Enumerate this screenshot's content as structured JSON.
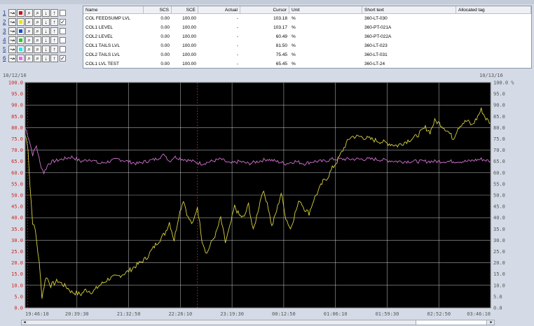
{
  "controls": {
    "rows": [
      {
        "num": "1",
        "color": "#cc1111",
        "checked": false
      },
      {
        "num": "2",
        "color": "#e8e800",
        "checked": true
      },
      {
        "num": "3",
        "color": "#1a4ad6",
        "checked": false
      },
      {
        "num": "4",
        "color": "#22cc22",
        "checked": false
      },
      {
        "num": "5",
        "color": "#22e8e8",
        "checked": false
      },
      {
        "num": "6",
        "color": "#ee66ee",
        "checked": true
      }
    ],
    "glyphs": {
      "trend": "↝",
      "zoom": "⌕",
      "down": "↓",
      "up": "↑",
      "check": "✓"
    }
  },
  "table": {
    "headers": {
      "name": "Name",
      "scs": "SCS",
      "sce": "SCE",
      "actual": "Actual",
      "cursor": "Cursor",
      "unit": "Unit",
      "short_text": "Short text",
      "allocated_tag": "Allocated tag"
    },
    "rows": [
      {
        "name": "COL FEEDSUMP LVL",
        "scs": "0.00",
        "sce": "100.00",
        "actual": "-",
        "cursor": "103.18",
        "unit": "%",
        "short_text": "360-LT-030",
        "allocated_tag": ""
      },
      {
        "name": "COL1 LEVEL",
        "scs": "0.00",
        "sce": "100.00",
        "actual": "-",
        "cursor": "103.17",
        "unit": "%",
        "short_text": "360-PT-021A",
        "allocated_tag": ""
      },
      {
        "name": "COL2 LEVEL",
        "scs": "0.00",
        "sce": "100.00",
        "actual": "-",
        "cursor": "60.49",
        "unit": "%",
        "short_text": "360-PT-022A",
        "allocated_tag": ""
      },
      {
        "name": "COL1 TAILS LVL",
        "scs": "0.00",
        "sce": "100.00",
        "actual": "-",
        "cursor": "81.50",
        "unit": "%",
        "short_text": "360-LT-023",
        "allocated_tag": ""
      },
      {
        "name": "COL2 TAILS LVL",
        "scs": "0.00",
        "sce": "100.00",
        "actual": "-",
        "cursor": "75.45",
        "unit": "%",
        "short_text": "360-LT-031",
        "allocated_tag": ""
      },
      {
        "name": "COL1 LVL TEST",
        "scs": "0.00",
        "sce": "100.00",
        "actual": "-",
        "cursor": "65.45",
        "unit": "%",
        "short_text": "360-LT-24",
        "allocated_tag": ""
      }
    ]
  },
  "trend": {
    "date_start": "10/12/16",
    "date_end": "10/13/16",
    "x_labels": [
      "19:46:10",
      "20:39:30",
      "21:32:50",
      "22:26:10",
      "23:19:30",
      "00:12:50",
      "01:06:10",
      "01:59:30",
      "02:52:50",
      "03:46:10"
    ],
    "left_axis_labels": [
      "100.0",
      "95.0",
      "90.0",
      "85.0",
      "80.0",
      "75.0",
      "70.0",
      "65.0",
      "60.0",
      "55.0",
      "50.0",
      "45.0",
      "40.0",
      "35.0",
      "30.0",
      "25.0",
      "20.0",
      "15.0",
      "10.0",
      "5.0",
      "0.0"
    ],
    "right_axis_labels": [
      "100.0 %",
      "95.0",
      "90.0",
      "85.0",
      "80.0",
      "75.0",
      "70.0",
      "65.0",
      "60.0",
      "55.0",
      "50.0",
      "45.0",
      "40.0",
      "35.0",
      "30.0",
      "25.0",
      "20.0",
      "15.0",
      "10.0",
      "5.0",
      "0.0"
    ],
    "y_range": [
      0,
      100
    ],
    "colors": {
      "background": "#000000",
      "grid": "#e0e0e0",
      "yellow": "#d8d040",
      "magenta": "#d070d0",
      "left_axis": "#cc2222",
      "right_axis": "#555555",
      "cursor_line": "#cc2222"
    },
    "yellow_series": [
      [
        0,
        77
      ],
      [
        0.6,
        71
      ],
      [
        1,
        55
      ],
      [
        1.6,
        38
      ],
      [
        2.2,
        34
      ],
      [
        3,
        20
      ],
      [
        3.6,
        5
      ],
      [
        4.5,
        14
      ],
      [
        5.5,
        10
      ],
      [
        7,
        12
      ],
      [
        9,
        9
      ],
      [
        10,
        7
      ],
      [
        12,
        6
      ],
      [
        13,
        8
      ],
      [
        14.5,
        7
      ],
      [
        16,
        10
      ],
      [
        18,
        13
      ],
      [
        20,
        14
      ],
      [
        22,
        16
      ],
      [
        24,
        19
      ],
      [
        26,
        22
      ],
      [
        28,
        28
      ],
      [
        30,
        33
      ],
      [
        31,
        38
      ],
      [
        32,
        30
      ],
      [
        33,
        41
      ],
      [
        34,
        48
      ],
      [
        35,
        40
      ],
      [
        36,
        37
      ],
      [
        37,
        45
      ],
      [
        38,
        30
      ],
      [
        39,
        24
      ],
      [
        40,
        29
      ],
      [
        41,
        33
      ],
      [
        42,
        40
      ],
      [
        43,
        29
      ],
      [
        44,
        36
      ],
      [
        45,
        45
      ],
      [
        46,
        41
      ],
      [
        47,
        40
      ],
      [
        48,
        46
      ],
      [
        49,
        34
      ],
      [
        50,
        43
      ],
      [
        51,
        52
      ],
      [
        52,
        47
      ],
      [
        53,
        36
      ],
      [
        54,
        43
      ],
      [
        55,
        51
      ],
      [
        56,
        40
      ],
      [
        57,
        35
      ],
      [
        58,
        42
      ],
      [
        59,
        48
      ],
      [
        60,
        44
      ],
      [
        61,
        42
      ],
      [
        62,
        48
      ],
      [
        63,
        52
      ],
      [
        64,
        56
      ],
      [
        65,
        58
      ],
      [
        66,
        62
      ],
      [
        67,
        65
      ],
      [
        68,
        69
      ],
      [
        69,
        73
      ],
      [
        70,
        76
      ],
      [
        72,
        76
      ],
      [
        74,
        75
      ],
      [
        76,
        74
      ],
      [
        78,
        73
      ],
      [
        80,
        72
      ],
      [
        82,
        74
      ],
      [
        84,
        76
      ],
      [
        85,
        78
      ],
      [
        86,
        80
      ],
      [
        87,
        78
      ],
      [
        88,
        83
      ],
      [
        89,
        82
      ],
      [
        90,
        80
      ],
      [
        91,
        78
      ],
      [
        92,
        75
      ],
      [
        93,
        80
      ],
      [
        94,
        82
      ],
      [
        95,
        83
      ],
      [
        96,
        81
      ],
      [
        97,
        84
      ],
      [
        98,
        88
      ],
      [
        99,
        84
      ],
      [
        100,
        82
      ]
    ],
    "magenta_series": [
      [
        0,
        80
      ],
      [
        0.8,
        75
      ],
      [
        1.6,
        68
      ],
      [
        2.4,
        72
      ],
      [
        3.2,
        64
      ],
      [
        4,
        60
      ],
      [
        5,
        64
      ],
      [
        6,
        65
      ],
      [
        8,
        66
      ],
      [
        10,
        67
      ],
      [
        12,
        65
      ],
      [
        14,
        66
      ],
      [
        16,
        64
      ],
      [
        18,
        65
      ],
      [
        20,
        66
      ],
      [
        22,
        65
      ],
      [
        24,
        64
      ],
      [
        26,
        65
      ],
      [
        28,
        66
      ],
      [
        30,
        68
      ],
      [
        31,
        65
      ],
      [
        32,
        67
      ],
      [
        34,
        66
      ],
      [
        36,
        65
      ],
      [
        38,
        64
      ],
      [
        40,
        65
      ],
      [
        42,
        66
      ],
      [
        44,
        64
      ],
      [
        46,
        65
      ],
      [
        48,
        64
      ],
      [
        50,
        65
      ],
      [
        52,
        66
      ],
      [
        54,
        65
      ],
      [
        56,
        64
      ],
      [
        58,
        65
      ],
      [
        60,
        64
      ],
      [
        62,
        65
      ],
      [
        64,
        65
      ],
      [
        66,
        66
      ],
      [
        68,
        66
      ],
      [
        70,
        66
      ],
      [
        75,
        66
      ],
      [
        80,
        65
      ],
      [
        85,
        65
      ],
      [
        90,
        65
      ],
      [
        95,
        65
      ],
      [
        98,
        66
      ],
      [
        100,
        65
      ]
    ],
    "cursor_marks": [
      0.5,
      37
    ]
  },
  "scrollbar": {
    "left_arrow": "◂",
    "right_arrow": "▸"
  }
}
